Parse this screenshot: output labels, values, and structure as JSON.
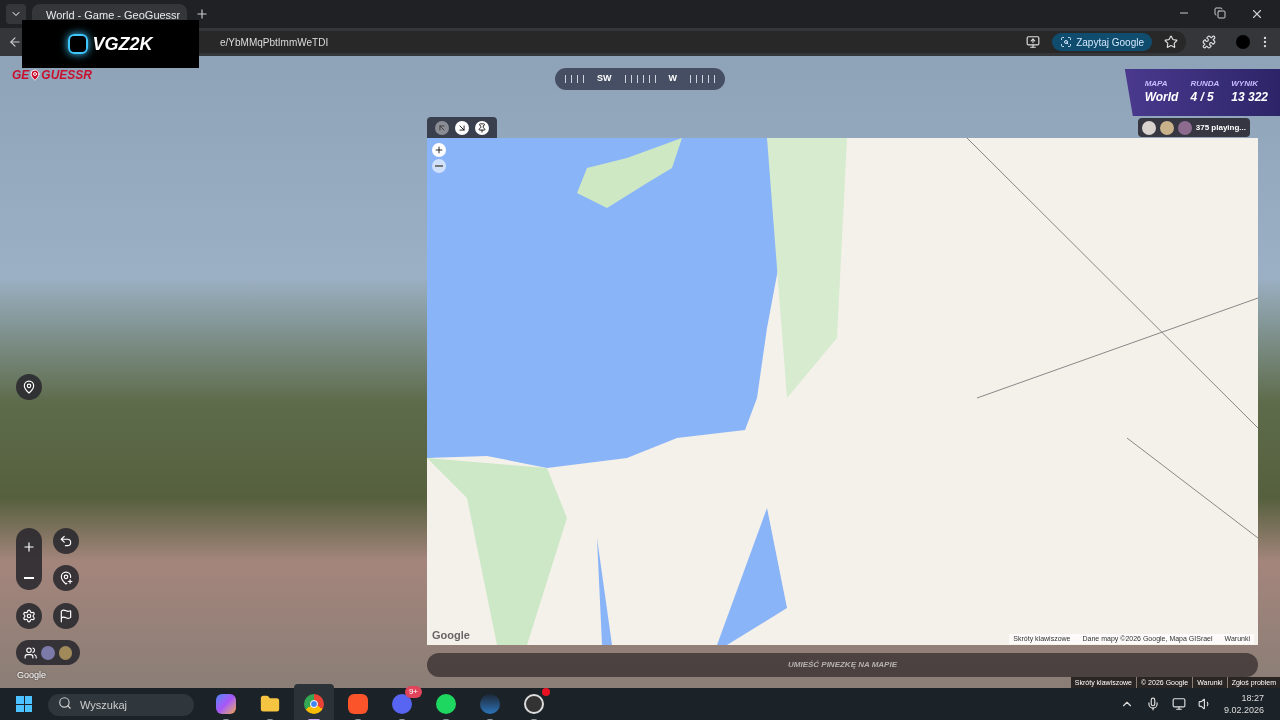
{
  "browser": {
    "tab": {
      "title": "World - Game - GeoGuessr",
      "selected": true
    },
    "url": "e/YbMMqPbtImmWeTDI",
    "ask_button": "Zapytaj Google"
  },
  "overlay": {
    "text": "VGZ2K"
  },
  "game": {
    "logo": [
      "GE",
      "GUESSR"
    ],
    "compass": [
      "SW",
      "W"
    ],
    "hud": [
      {
        "label": "MAPA",
        "value": "World"
      },
      {
        "label": "RUNDA",
        "value": "4 / 5"
      },
      {
        "label": "WYNIK",
        "value": "13 322"
      }
    ],
    "players": "375 playing...",
    "map_tools": [
      {
        "kind": "shrink",
        "selected": true
      },
      {
        "kind": "grow",
        "selected": false
      },
      {
        "kind": "pin",
        "selected": false
      }
    ],
    "map_google": "Google",
    "map_footer": [
      "Skróty klawiszowe",
      "Dane mapy ©2026 Google, Mapa GISrael",
      "Warunki"
    ],
    "guess_button": {
      "label": "UMIEŚĆ PINEZKĘ NA MAPIE",
      "disabled": true
    },
    "streetview_google": "Google",
    "streetview_footer": [
      "Skróty klawiszowe",
      "© 2026 Google",
      "Warunki",
      "Zgłoś problem"
    ]
  },
  "taskbar": {
    "search": {
      "placeholder": "Wyszukaj"
    },
    "apps": [
      {
        "kind": "copilot",
        "selected": false,
        "alert": false
      },
      {
        "kind": "files",
        "selected": false,
        "alert": false
      },
      {
        "kind": "chrome",
        "selected": true,
        "alert": false
      },
      {
        "kind": "brave",
        "selected": false,
        "alert": false
      },
      {
        "kind": "discord",
        "selected": false,
        "badge": "9+",
        "alert": false
      },
      {
        "kind": "spotify",
        "selected": false,
        "alert": false
      },
      {
        "kind": "steam",
        "selected": false,
        "alert": false
      },
      {
        "kind": "obs",
        "selected": false,
        "alert": true
      }
    ],
    "time": "18:27",
    "date": "9.02.2026"
  }
}
